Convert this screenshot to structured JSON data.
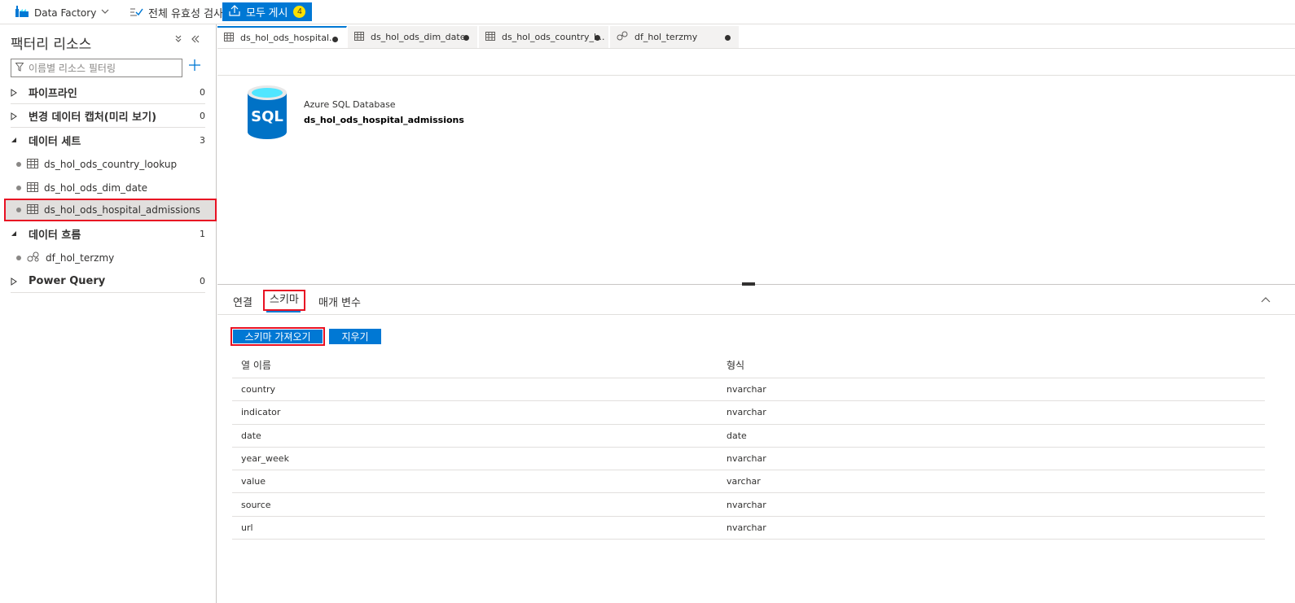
{
  "toolbar": {
    "factory_label": "Data Factory",
    "validate_label": "전체 유효성 검사",
    "publish_label": "모두 게시",
    "publish_badge": "4"
  },
  "sidebar": {
    "title": "팩터리 리소스",
    "filter_placeholder": "이름별 리소스 필터링",
    "groups": [
      {
        "label": "파이프라인",
        "count": "0"
      },
      {
        "label": "변경 데이터 캡처(미리 보기)",
        "count": "0"
      },
      {
        "label": "데이터 세트",
        "count": "3"
      },
      {
        "label": "데이터 흐름",
        "count": "1"
      },
      {
        "label": "Power Query",
        "count": "0"
      }
    ],
    "datasets": [
      {
        "label": "ds_hol_ods_country_lookup"
      },
      {
        "label": "ds_hol_ods_dim_date"
      },
      {
        "label": "ds_hol_ods_hospital_admissions"
      }
    ],
    "dataflows": [
      {
        "label": "df_hol_terzmy"
      }
    ]
  },
  "tabs": [
    {
      "label": "ds_hol_ods_hospital..."
    },
    {
      "label": "ds_hol_ods_dim_date"
    },
    {
      "label": "ds_hol_ods_country_l..."
    },
    {
      "label": "df_hol_terzmy"
    }
  ],
  "dataset": {
    "icon_text": "SQL",
    "type": "Azure SQL Database",
    "name": "ds_hol_ods_hospital_admissions"
  },
  "bottom_tabs": {
    "connection": "연결",
    "schema": "스키마",
    "parameters": "매개 변수"
  },
  "buttons": {
    "import_schema": "스키마 가져오기",
    "clear": "지우기"
  },
  "schema": {
    "headers": [
      "열 이름",
      "형식"
    ],
    "rows": [
      {
        "name": "country",
        "type": "nvarchar"
      },
      {
        "name": "indicator",
        "type": "nvarchar"
      },
      {
        "name": "date",
        "type": "date"
      },
      {
        "name": "year_week",
        "type": "nvarchar"
      },
      {
        "name": "value",
        "type": "varchar"
      },
      {
        "name": "source",
        "type": "nvarchar"
      },
      {
        "name": "url",
        "type": "nvarchar"
      }
    ]
  },
  "colors": {
    "accent": "#0078d4",
    "highlight": "#e81123",
    "badge": "#fce100"
  }
}
